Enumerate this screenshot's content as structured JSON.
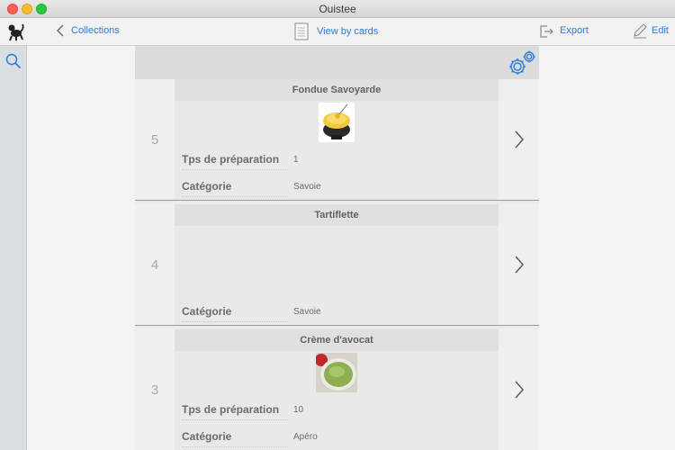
{
  "window": {
    "title": "Ouistee"
  },
  "toolbar": {
    "back_label": "Collections",
    "view_label": "View by cards",
    "export_label": "Export",
    "edit_label": "Edit"
  },
  "field_labels": {
    "prep_time": "Tps de préparation",
    "category": "Catégorie"
  },
  "cards": [
    {
      "index": "5",
      "title": "Fondue Savoyarde",
      "prep_time": "1",
      "category": "Savoie",
      "image": "fondue-photo"
    },
    {
      "index": "4",
      "title": "Tartiflette",
      "prep_time": "",
      "category": "Savoie",
      "image": ""
    },
    {
      "index": "3",
      "title": "Crème d'avocat",
      "prep_time": "10",
      "category": "Apéro",
      "image": "avocado-cream-photo"
    }
  ],
  "colors": {
    "accent": "#2f7bd6",
    "column": "#ebebeb",
    "header": "#dcdcdc"
  }
}
